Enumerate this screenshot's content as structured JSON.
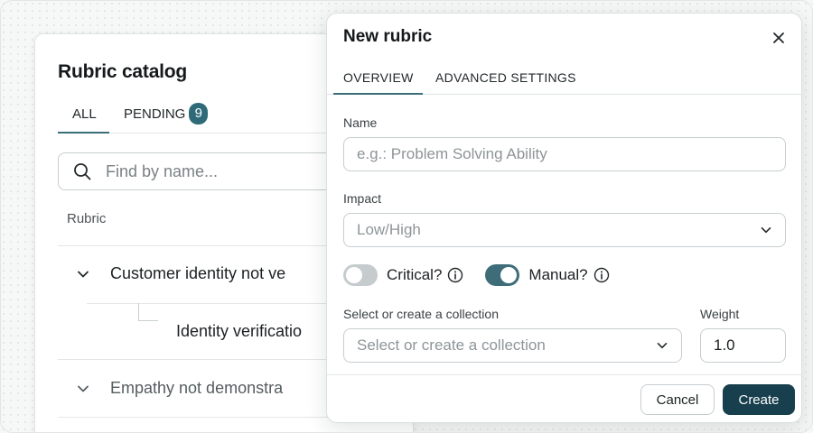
{
  "catalog": {
    "title": "Rubric catalog",
    "tabs": [
      {
        "label": "ALL"
      },
      {
        "label": "PENDING",
        "badge": "9"
      }
    ],
    "search_placeholder": "Find by name...",
    "column_header": "Rubric",
    "rows": [
      {
        "label": "Customer identity not ve"
      },
      {
        "label": "Identity verificatio"
      },
      {
        "label": "Empathy not demonstra"
      }
    ]
  },
  "modal": {
    "title": "New rubric",
    "tabs": [
      {
        "label": "OVERVIEW"
      },
      {
        "label": "ADVANCED SETTINGS"
      }
    ],
    "name_label": "Name",
    "name_placeholder": "e.g.: Problem Solving Ability",
    "impact_label": "Impact",
    "impact_value": "Low/High",
    "critical_label": "Critical?",
    "critical_on": false,
    "manual_label": "Manual?",
    "manual_on": true,
    "collection_label": "Select or create a collection",
    "collection_placeholder": "Select or create a collection",
    "weight_label": "Weight",
    "weight_value": "1.0",
    "cancel_label": "Cancel",
    "create_label": "Create"
  },
  "colors": {
    "accent": "#3c6e7a",
    "primary_button": "#173f4d",
    "toggle_on": "#3e6d79",
    "toggle_off": "#c6cbcd"
  }
}
